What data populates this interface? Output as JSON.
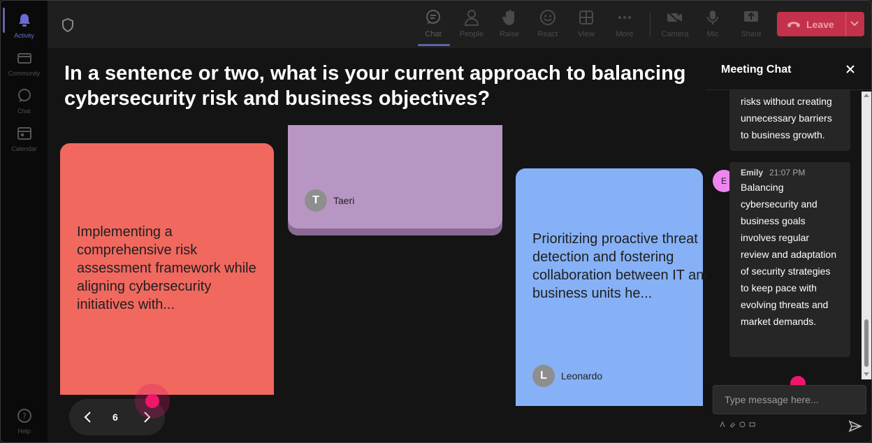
{
  "rail": {
    "items": [
      {
        "label": "Activity",
        "icon": "bell-icon",
        "active": true
      },
      {
        "label": "Community",
        "icon": "community-icon"
      },
      {
        "label": "Chat",
        "icon": "chat-icon"
      },
      {
        "label": "Calendar",
        "icon": "calendar-icon"
      }
    ],
    "help": {
      "label": "Help",
      "icon": "help-icon"
    }
  },
  "toolbar": {
    "chat": "Chat",
    "people": "People",
    "raise": "Raise",
    "react": "React",
    "view": "View",
    "more": "More",
    "camera": "Camera",
    "mic": "Mic",
    "share": "Share",
    "leave": "Leave"
  },
  "stage": {
    "question": "In a sentence or two, what is your current approach to balancing cybersecurity risk and business objectives?",
    "cards": [
      {
        "color": "#f1685f",
        "text": "Implementing a comprehensive risk assessment framework while aligning cybersecurity initiatives with..."
      },
      {
        "color": "#b896c4",
        "author": "Taeri",
        "initial": "T"
      },
      {
        "color": "#86b1f6",
        "text": "Prioritizing proactive threat detection and fostering collaboration between IT and business units he...",
        "author": "Leonardo",
        "initial": "L"
      }
    ],
    "pager": {
      "page": "6"
    }
  },
  "chat": {
    "title": "Meeting Chat",
    "messages": [
      {
        "text": "risks without creating unnecessary barriers to business growth."
      },
      {
        "sender": "Emily",
        "initial": "E",
        "time": "21:07 PM",
        "text": "Balancing cybersecurity and business goals involves regular review and adaptation of security strategies to keep pace with evolving threats and market demands."
      }
    ],
    "compose_placeholder": "Type message here..."
  },
  "colors": {
    "accent": "#6264a7",
    "leave": "#c4314b",
    "pointer": "#f0166a"
  }
}
